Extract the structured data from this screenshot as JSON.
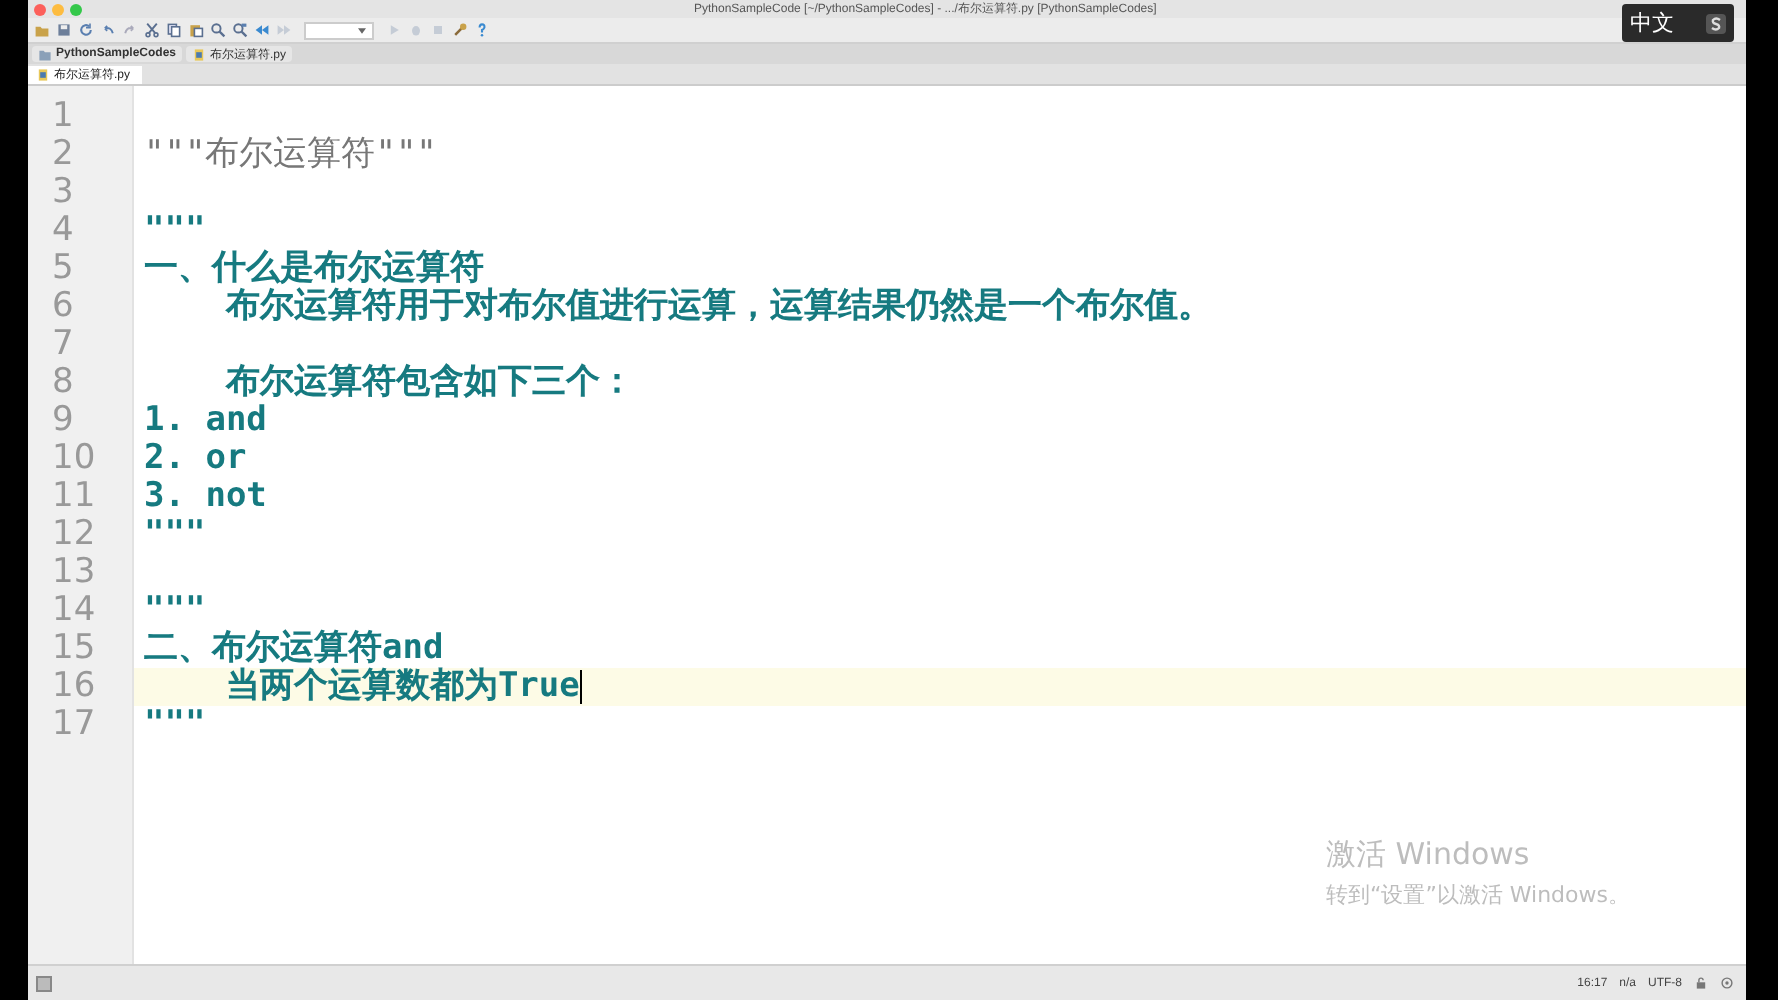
{
  "window": {
    "title": "PythonSampleCode [~/PythonSampleCodes] - .../布尔运算符.py [PythonSampleCodes]"
  },
  "navigation_bar": [
    {
      "label": "PythonSampleCodes",
      "kind": "folder"
    },
    {
      "label": "布尔运算符.py",
      "kind": "file"
    }
  ],
  "editor_tabs": [
    {
      "label": "布尔运算符.py",
      "selected": true
    }
  ],
  "ime_indicator": {
    "label": "中文"
  },
  "code_lines": [
    {
      "number": "1",
      "kind": "plain",
      "current": false
    },
    {
      "number": "2",
      "text": "\"\"\"布尔运算符\"\"\"",
      "kind": "plain",
      "current": false
    },
    {
      "number": "3",
      "kind": "plain",
      "current": false
    },
    {
      "number": "4",
      "text": "\"\"\"",
      "kind": "doc",
      "current": false
    },
    {
      "number": "5",
      "text": "一、什么是布尔运算符",
      "kind": "doc",
      "current": false
    },
    {
      "number": "6",
      "text": "    布尔运算符用于对布尔值进行运算，运算结果仍然是一个布尔值。",
      "kind": "doc",
      "current": false
    },
    {
      "number": "7",
      "kind": "doc",
      "current": false
    },
    {
      "number": "8",
      "text": "    布尔运算符包含如下三个：",
      "kind": "doc",
      "current": false
    },
    {
      "number": "9",
      "text": "1. and",
      "kind": "doc",
      "current": false
    },
    {
      "number": "10",
      "text": "2. or",
      "kind": "doc",
      "current": false
    },
    {
      "number": "11",
      "text": "3. not",
      "kind": "doc",
      "current": false
    },
    {
      "number": "12",
      "text": "\"\"\"",
      "kind": "doc",
      "current": false
    },
    {
      "number": "13",
      "kind": "plain",
      "current": false
    },
    {
      "number": "14",
      "text": "\"\"\"",
      "kind": "doc",
      "current": false
    },
    {
      "number": "15",
      "text": "二、布尔运算符and",
      "kind": "doc",
      "current": false
    },
    {
      "number": "16",
      "text": "    当两个运算数都为True",
      "kind": "doc",
      "current": true
    },
    {
      "number": "17",
      "text": "\"\"\"",
      "kind": "doc",
      "current": false
    }
  ],
  "activation_notice": {
    "title": "激活 Windows",
    "subtitle": "转到“设置”以激活 Windows。"
  },
  "status_bar": {
    "position": "16:17",
    "line_separator": "n/a",
    "encoding": "UTF-8"
  }
}
